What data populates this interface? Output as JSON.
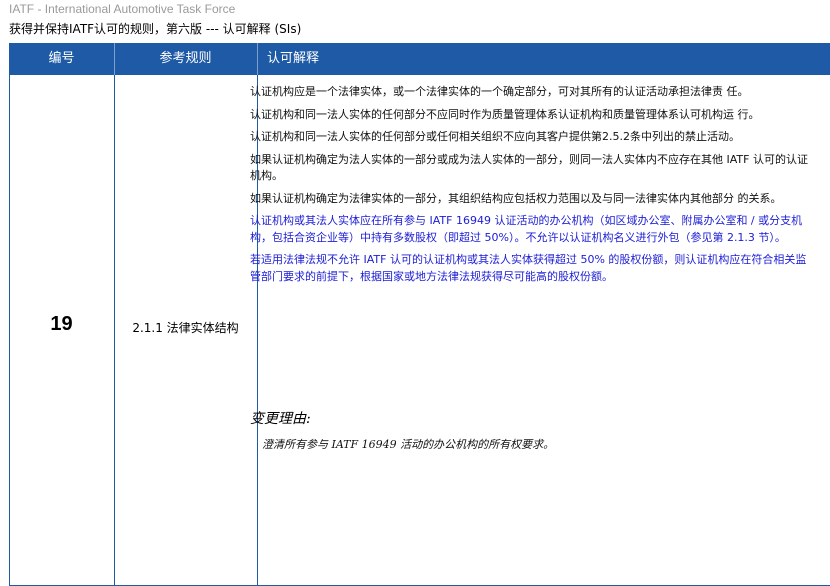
{
  "header": {
    "org": "IATF - International Automotive Task Force",
    "title": "获得并保持IATF认可的规则，第六版 --- 认可解释 (SIs)"
  },
  "table": {
    "columns": [
      "编号",
      "参考规则",
      "认可解释"
    ],
    "row": {
      "number": "19",
      "rule": "2.1.1 法律实体结构",
      "paragraphs": [
        "认证机构应是一个法律实体，或一个法律实体的一个确定部分，可对其所有的认证活动承担法律责 任。",
        "认证机构和同一法人实体的任何部分不应同时作为质量管理体系认证机构和质量管理体系认可机构运 行。",
        "认证机构和同一法人实体的任何部分或任何相关组织不应向其客户提供第2.5.2条中列出的禁止活动。",
        "如果认证机构确定为法人实体的一部分或成为法人实体的一部分，则同一法人实体内不应存在其他 IATF 认可的认证机构。",
        "如果认证机构确定为法律实体的一部分，其组织结构应包括权力范围以及与同一法律实体内其他部分 的关系。",
        "认证机构或其法人实体应在所有参与 IATF 16949 认证活动的办公机构（如区域办公室、附属办公室和 / 或分支机构，包括合资企业等）中持有多数股权（即超过 50%）。不允许以认证机构名义进行外包（参见第 2.1.3 节）。",
        "若适用法律法规不允许 IATF 认可的认证机构或其法人实体获得超过 50% 的股权份额，则认证机构应在符合相关监管部门要求的前提下，根据国家或地方法律法规获得尽可能高的股权份额。"
      ],
      "reason_title": "变更理由:",
      "reason_text": "澄清所有参与 IATF 16949 活动的办公机构的所有权要求。"
    }
  },
  "colors": {
    "header_bg": "#1f5aa6",
    "highlight_text": "#1c1cd6"
  }
}
